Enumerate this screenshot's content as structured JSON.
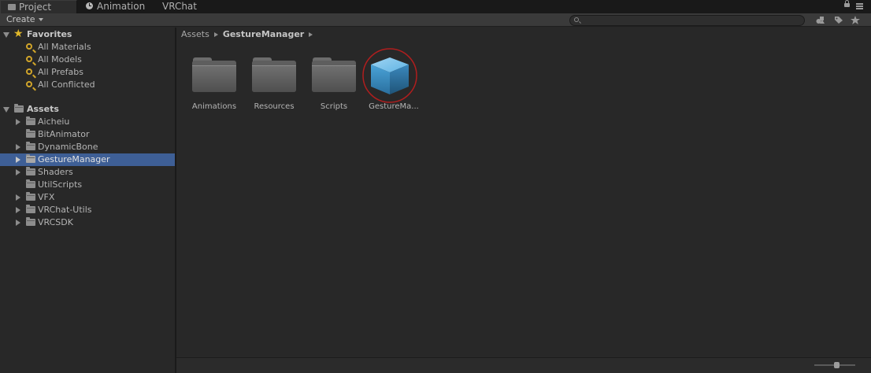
{
  "tabs": [
    {
      "label": "Project",
      "icon": "project-icon",
      "active": true
    },
    {
      "label": "Animation",
      "icon": "animation-clock-icon",
      "active": false
    },
    {
      "label": "VRChat",
      "icon": "",
      "active": false
    }
  ],
  "toolbar": {
    "create_label": "Create",
    "search_placeholder": ""
  },
  "sidebar": {
    "favorites": {
      "label": "Favorites",
      "items": [
        "All Materials",
        "All Models",
        "All Prefabs",
        "All Conflicted"
      ]
    },
    "assets": {
      "label": "Assets",
      "items": [
        {
          "label": "Aicheiu",
          "expandable": true,
          "selected": false
        },
        {
          "label": "BitAnimator",
          "expandable": false,
          "selected": false
        },
        {
          "label": "DynamicBone",
          "expandable": true,
          "selected": false
        },
        {
          "label": "GestureManager",
          "expandable": true,
          "selected": true
        },
        {
          "label": "Shaders",
          "expandable": true,
          "selected": false
        },
        {
          "label": "UtilScripts",
          "expandable": false,
          "selected": false
        },
        {
          "label": "VFX",
          "expandable": true,
          "selected": false
        },
        {
          "label": "VRChat-Utils",
          "expandable": true,
          "selected": false
        },
        {
          "label": "VRCSDK",
          "expandable": true,
          "selected": false
        }
      ]
    }
  },
  "breadcrumb": {
    "root": "Assets",
    "current": "GestureManager"
  },
  "grid_items": [
    {
      "label": "Animations",
      "type": "folder"
    },
    {
      "label": "Resources",
      "type": "folder"
    },
    {
      "label": "Scripts",
      "type": "folder"
    },
    {
      "label": "GestureMa...",
      "type": "prefab",
      "highlighted": true
    }
  ],
  "colors": {
    "selection": "#3e5f96",
    "highlight_ring": "#b01e1e",
    "favorites_icon": "#d1a52a",
    "prefab_cube": "#4aa3d8"
  }
}
